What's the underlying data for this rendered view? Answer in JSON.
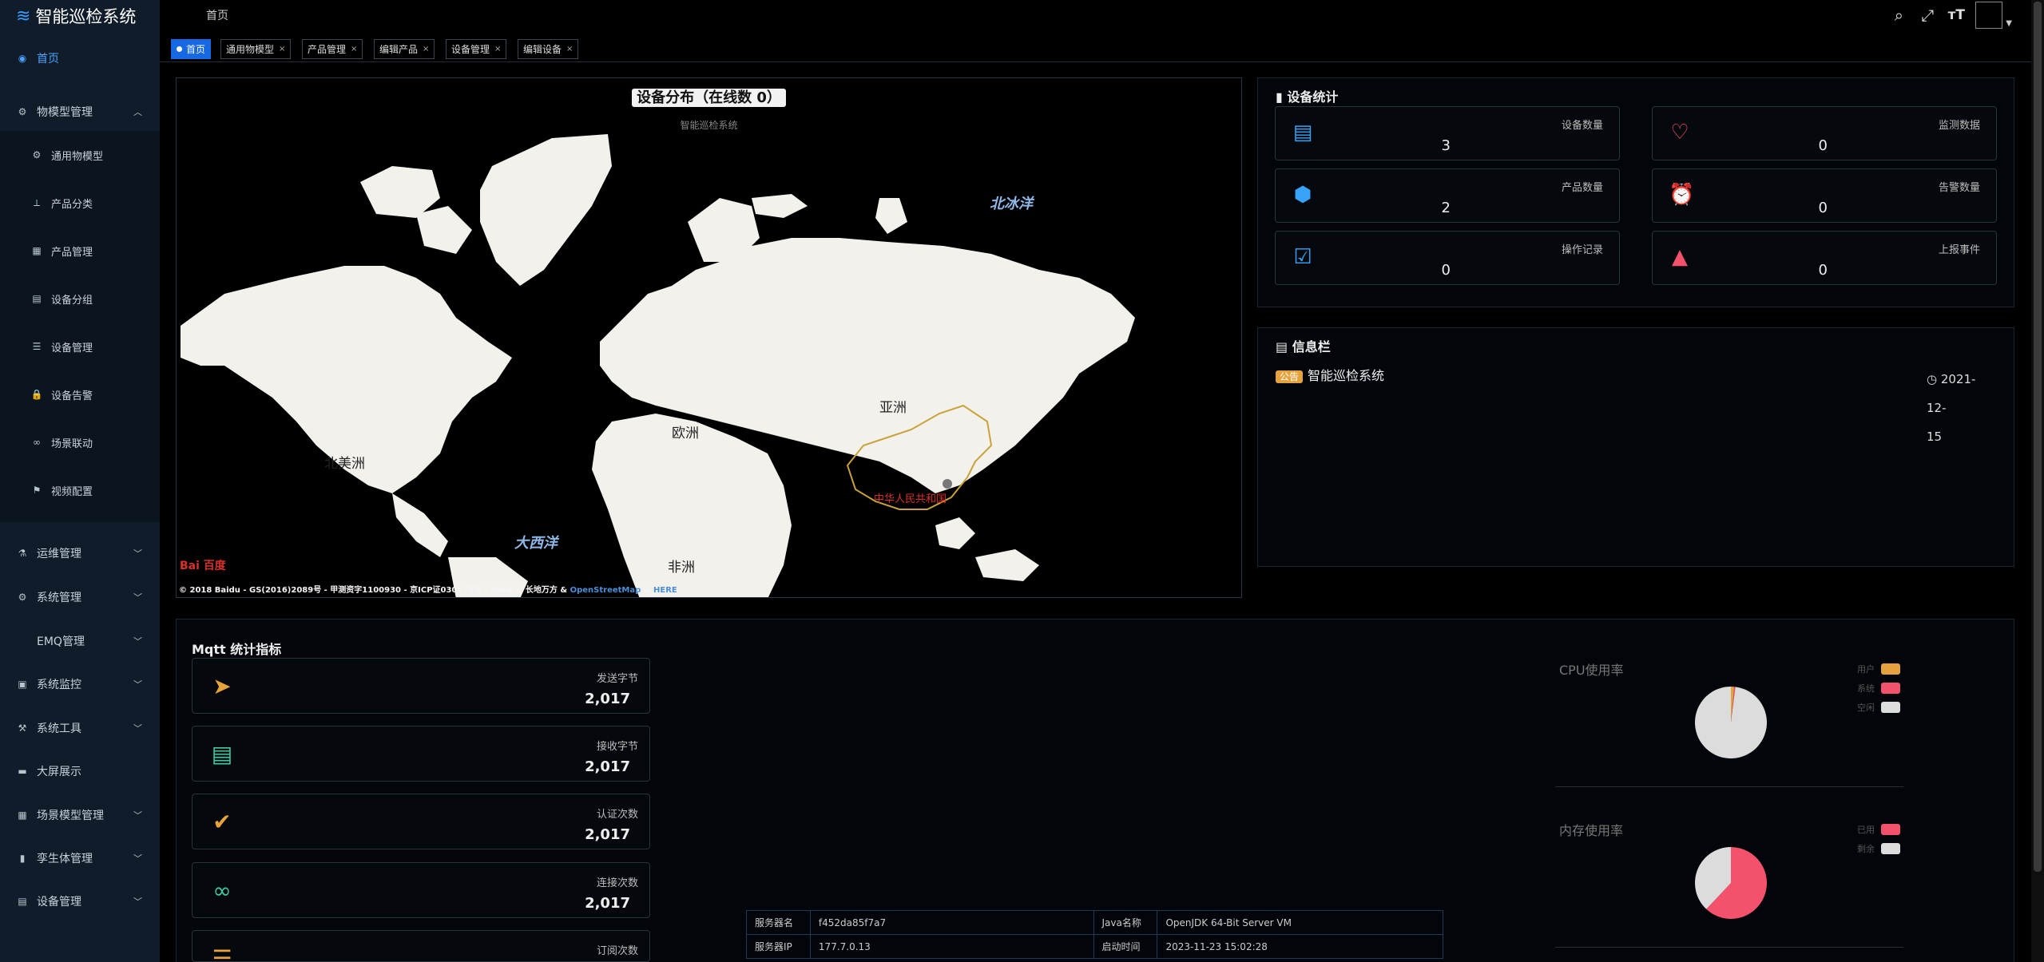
{
  "app": {
    "title": "智能巡检系统",
    "logo_icon": "wave-logo-icon"
  },
  "sidebar": {
    "items": [
      {
        "label": "首页",
        "icon": "dashboard-icon",
        "active": true
      },
      {
        "label": "物模型管理",
        "icon": "gear-icon",
        "expanded": true
      },
      {
        "label": "通用物模型",
        "icon": "gear-icon",
        "sub": true
      },
      {
        "label": "产品分类",
        "icon": "tree-icon",
        "sub": true
      },
      {
        "label": "产品管理",
        "icon": "grid-icon",
        "sub": true
      },
      {
        "label": "设备分组",
        "icon": "table-icon",
        "sub": true
      },
      {
        "label": "设备管理",
        "icon": "list-icon",
        "sub": true
      },
      {
        "label": "设备告警",
        "icon": "lock-icon",
        "sub": true
      },
      {
        "label": "场景联动",
        "icon": "link-icon",
        "sub": true
      },
      {
        "label": "视频配置",
        "icon": "flag-icon",
        "sub": true
      },
      {
        "label": "运维管理",
        "icon": "org-icon"
      },
      {
        "label": "系统管理",
        "icon": "gear-icon"
      },
      {
        "label": "EMQ管理",
        "icon": ""
      },
      {
        "label": "系统监控",
        "icon": "monitor-icon"
      },
      {
        "label": "系统工具",
        "icon": "tool-icon"
      },
      {
        "label": "大屏展示",
        "icon": "screen-icon"
      },
      {
        "label": "场景模型管理",
        "icon": "grid-icon"
      },
      {
        "label": "孪生体管理",
        "icon": "chart-icon"
      },
      {
        "label": "设备管理",
        "icon": "table-icon"
      }
    ]
  },
  "header": {
    "breadcrumb": "首页"
  },
  "tags": [
    {
      "label": "首页",
      "active": true
    },
    {
      "label": "通用物模型",
      "close": "×"
    },
    {
      "label": "产品管理",
      "close": "×"
    },
    {
      "label": "编辑产品",
      "close": "×"
    },
    {
      "label": "设备管理",
      "close": "×"
    },
    {
      "label": "编辑设备",
      "close": "×"
    }
  ],
  "map": {
    "title": "设备分布（在线数 0）",
    "subtitle": "智能巡检系统",
    "labels": {
      "north_america": "北美洲",
      "europe": "欧洲",
      "asia": "亚洲",
      "africa": "非洲",
      "arctic": "北冰洋",
      "atlantic": "大西洋",
      "china": "中华人民共和国"
    },
    "copyright": "© 2018 Baidu - GS(2016)2089号 - 甲测资字1100930 - 京ICP证030173号 - Data © 长地万方 &",
    "osm": "OpenStreetMap",
    "amp": "&",
    "here": "HERE",
    "baidu_logo": "Bai 百度"
  },
  "device_stats": {
    "title": "设备统计",
    "cards": [
      {
        "label": "设备数量",
        "value": "3",
        "icon": "server-icon",
        "color": "#36a3f7"
      },
      {
        "label": "监测数据",
        "value": "0",
        "icon": "pulse-icon",
        "color": "#f4516c"
      },
      {
        "label": "产品数量",
        "value": "2",
        "icon": "cube-icon",
        "color": "#36a3f7"
      },
      {
        "label": "告警数量",
        "value": "0",
        "icon": "alarm-icon",
        "color": "#f4516c"
      },
      {
        "label": "操作记录",
        "value": "0",
        "icon": "clipboard-icon",
        "color": "#36a3f7"
      },
      {
        "label": "上报事件",
        "value": "0",
        "icon": "warning-icon",
        "color": "#f4516c"
      }
    ]
  },
  "notice": {
    "title": "信息栏",
    "badge": "公告",
    "text": "智能巡检系统",
    "date_line1": "2021-12-",
    "date_line2": "15"
  },
  "mqtt": {
    "title": "Mqtt 统计指标",
    "cards": [
      {
        "label": "发送字节",
        "value": "2,017",
        "icon": "send-icon",
        "color": "#e6a23c"
      },
      {
        "label": "接收字节",
        "value": "2,017",
        "icon": "receive-icon",
        "color": "#40c9a2"
      },
      {
        "label": "认证次数",
        "value": "2,017",
        "icon": "user-check-icon",
        "color": "#e6a23c"
      },
      {
        "label": "连接次数",
        "value": "2,017",
        "icon": "link-icon",
        "color": "#40c9a2"
      },
      {
        "label": "订阅次数",
        "value": "",
        "icon": "list-icon",
        "color": "#e6a23c"
      }
    ]
  },
  "server": {
    "rows": [
      [
        "服务器名",
        "f452da85f7a7",
        "Java名称",
        "OpenJDK 64-Bit Server VM"
      ],
      [
        "服务器IP",
        "177.7.0.13",
        "启动时间",
        "2023-11-23 15:02:28"
      ]
    ]
  },
  "cpu": {
    "title": "CPU使用率",
    "legend": [
      {
        "label": "用户",
        "color": "#e6a23c"
      },
      {
        "label": "系统",
        "color": "#f4516c"
      },
      {
        "label": "空闲",
        "color": "#dcdcdc"
      }
    ],
    "values": [
      1.5,
      0.5,
      98
    ]
  },
  "memory": {
    "title": "内存使用率",
    "legend": [
      {
        "label": "已用",
        "color": "#f4516c"
      },
      {
        "label": "剩余",
        "color": "#dcdcdc"
      }
    ],
    "values": [
      62,
      38
    ]
  },
  "colors": {
    "sidebar_bg": "#111c2a",
    "accent": "#1668e3",
    "china_border": "#c9a33a",
    "china_label": "#d9302a"
  }
}
